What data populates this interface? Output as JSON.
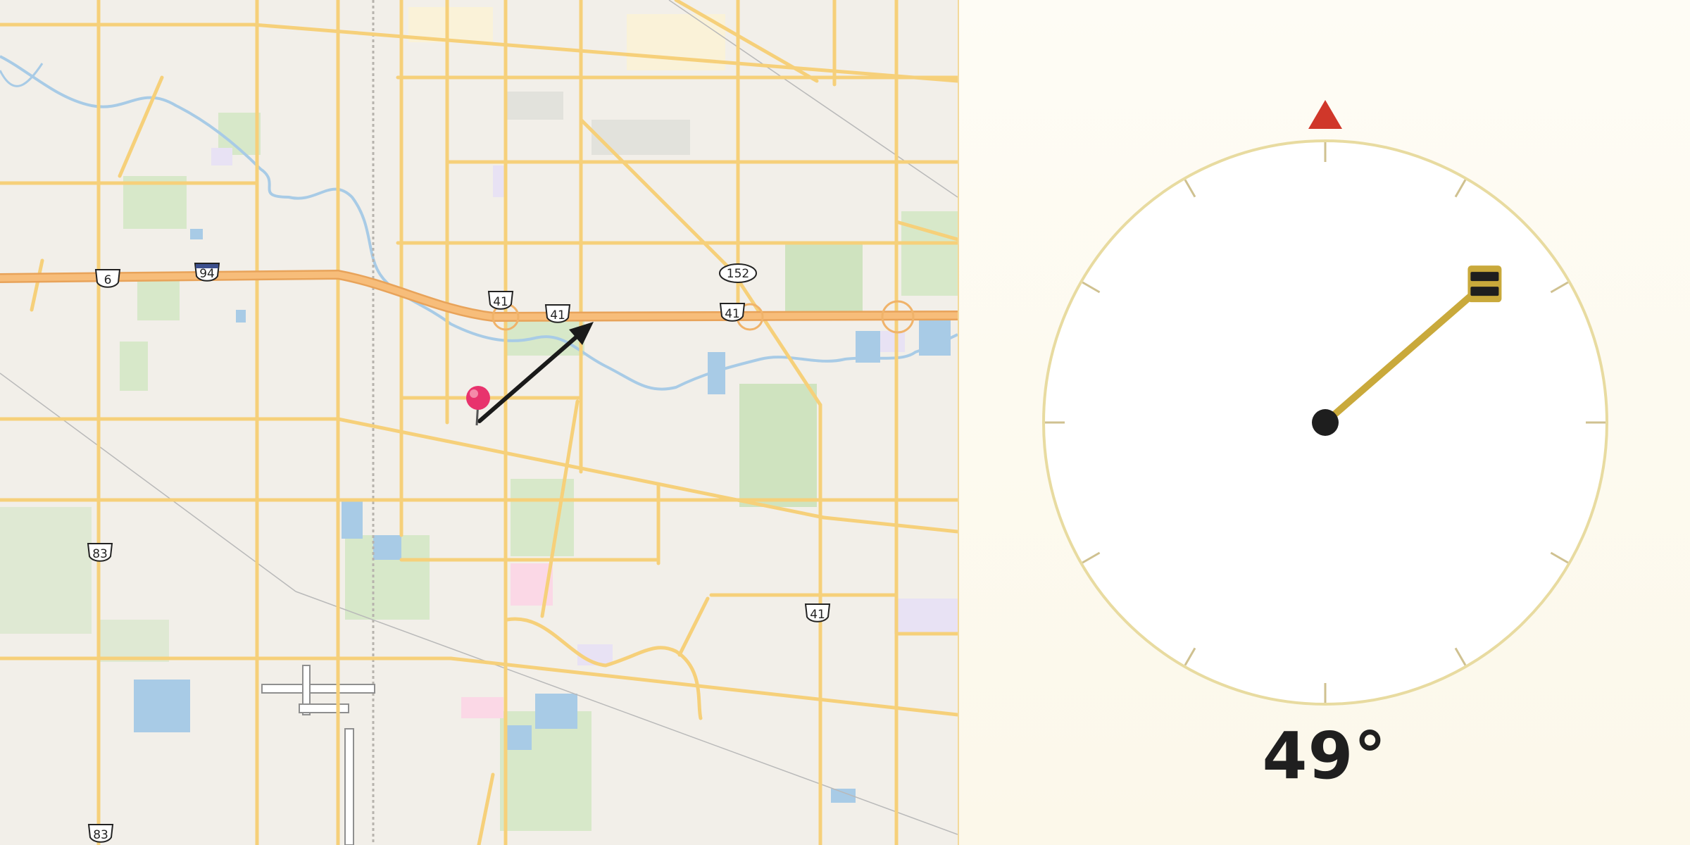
{
  "map": {
    "route_shields": [
      {
        "label": "6",
        "type": "us"
      },
      {
        "label": "94",
        "type": "interstate"
      },
      {
        "label": "41",
        "type": "us"
      },
      {
        "label": "41",
        "type": "us"
      },
      {
        "label": "152",
        "type": "state"
      },
      {
        "label": "41",
        "type": "us"
      },
      {
        "label": "83",
        "type": "us"
      },
      {
        "label": "41",
        "type": "us"
      },
      {
        "label": "83",
        "type": "us"
      }
    ],
    "marker_icon": "pushpin-icon",
    "marker_color": "#e8336d",
    "direction_arrow_color": "#1a1a1a"
  },
  "compass": {
    "heading_degrees": 49,
    "heading_label": "49°",
    "north_marker_color": "#d0372a",
    "needle_color": "#c9a93b",
    "dial_ring_color": "#e8dba0"
  }
}
